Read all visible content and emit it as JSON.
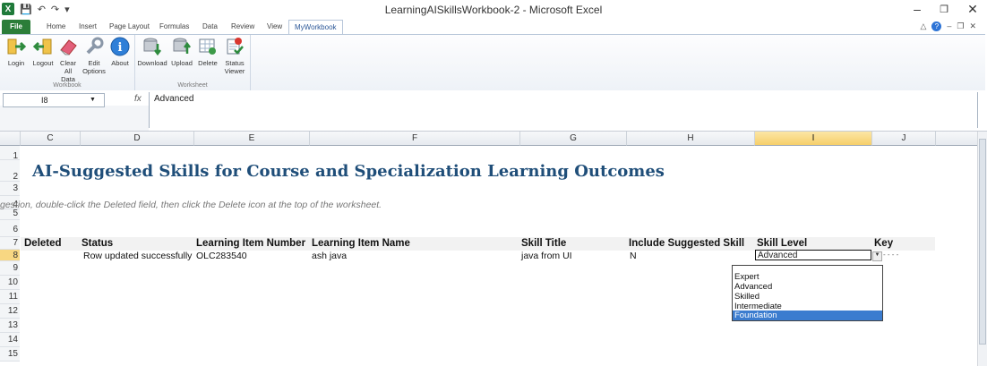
{
  "window": {
    "title": "LearningAISkillsWorkbook-2 - Microsoft Excel"
  },
  "ribbon_tabs": [
    {
      "label": "File"
    },
    {
      "label": "Home"
    },
    {
      "label": "Insert"
    },
    {
      "label": "Page Layout"
    },
    {
      "label": "Formulas"
    },
    {
      "label": "Data"
    },
    {
      "label": "Review"
    },
    {
      "label": "View"
    },
    {
      "label": "MyWorkbook"
    }
  ],
  "groups": {
    "workbook": {
      "label": "Workbook",
      "buttons": [
        {
          "label": "Login",
          "icon": "login-icon"
        },
        {
          "label": "Logout",
          "icon": "logout-icon"
        },
        {
          "label": "Clear All Data",
          "icon": "eraser-icon"
        },
        {
          "label": "Edit Options",
          "icon": "wrench-icon"
        },
        {
          "label": "About",
          "icon": "info-icon"
        }
      ]
    },
    "worksheet": {
      "label": "Worksheet",
      "buttons": [
        {
          "label": "Download",
          "icon": "database-download-icon"
        },
        {
          "label": "Upload",
          "icon": "database-upload-icon"
        },
        {
          "label": "Delete",
          "icon": "delete-sheet-icon"
        },
        {
          "label": "Status Viewer",
          "icon": "status-viewer-icon"
        }
      ]
    }
  },
  "formula_bar": {
    "name_box": "I8",
    "fx": "fx",
    "value": "Advanced"
  },
  "columns": [
    "C",
    "D",
    "E",
    "F",
    "G",
    "H",
    "I",
    "J"
  ],
  "selected_column": "I",
  "rows": [
    "1",
    "2",
    "3",
    "4",
    "5",
    "6",
    "7",
    "8",
    "9",
    "10",
    "11",
    "12",
    "13",
    "14",
    "15"
  ],
  "selected_row": "8",
  "sheet": {
    "title": "AI-Suggested Skills for Course and Specialization Learning Outcomes",
    "hint": "gestion, double-click the Deleted field, then click the Delete icon at the top of the worksheet.",
    "headers": [
      "Deleted",
      "Status",
      "Learning Item Number",
      "Learning Item Name",
      "Skill Title",
      "Include Suggested Skill",
      "Skill Level",
      "Key"
    ],
    "row8": {
      "status": "Row updated successfully",
      "item_number": "OLC283540",
      "item_name": "ash java",
      "skill_title": "java  from UI",
      "include": "N",
      "skill_level": "Advanced",
      "key": "- - - -"
    }
  },
  "dropdown": {
    "options": [
      "Expert",
      "Advanced",
      "Skilled",
      "Intermediate",
      "Foundation"
    ],
    "highlighted": "Foundation"
  },
  "colors": {
    "file_tab": "#2b7d39",
    "title": "#1f4e79",
    "selection": "#3b7ccf",
    "selected_header": "#f6cf6a"
  }
}
